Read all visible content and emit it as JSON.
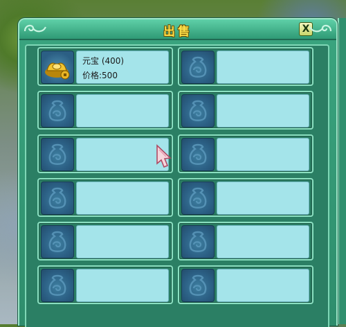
{
  "window": {
    "title": "出售",
    "close_label": "X"
  },
  "slots": [
    {
      "name": "元宝 (400)",
      "price": "价格:500",
      "icon": "gold-ingot-icon",
      "filled": true
    },
    {
      "name": "",
      "price": "",
      "icon": "empty-bag-icon",
      "filled": false
    },
    {
      "name": "",
      "price": "",
      "icon": "empty-bag-icon",
      "filled": false
    },
    {
      "name": "",
      "price": "",
      "icon": "empty-bag-icon",
      "filled": false
    },
    {
      "name": "",
      "price": "",
      "icon": "empty-bag-icon",
      "filled": false
    },
    {
      "name": "",
      "price": "",
      "icon": "empty-bag-icon",
      "filled": false
    },
    {
      "name": "",
      "price": "",
      "icon": "empty-bag-icon",
      "filled": false
    },
    {
      "name": "",
      "price": "",
      "icon": "empty-bag-icon",
      "filled": false
    },
    {
      "name": "",
      "price": "",
      "icon": "empty-bag-icon",
      "filled": false
    },
    {
      "name": "",
      "price": "",
      "icon": "empty-bag-icon",
      "filled": false
    },
    {
      "name": "",
      "price": "",
      "icon": "empty-bag-icon",
      "filled": false
    },
    {
      "name": "",
      "price": "",
      "icon": "empty-bag-icon",
      "filled": false
    }
  ],
  "colors": {
    "panel": "#2e8d6c",
    "slot_info": "#a4e4ea",
    "title_text": "#ffe24a"
  }
}
